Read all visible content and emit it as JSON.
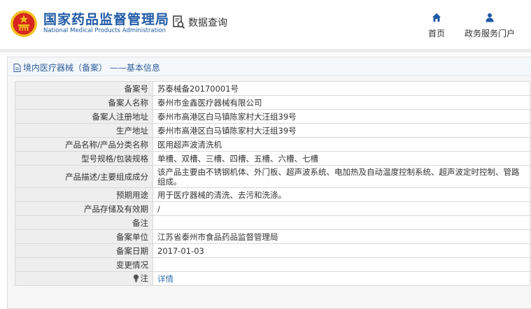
{
  "header": {
    "brand_cn": "国家药品监督管理局",
    "brand_en": "National Medical Products Administration",
    "query_label": "数据查询",
    "nav": {
      "home": "首页",
      "portal": "政务服务门户"
    }
  },
  "panel": {
    "title": "境内医疗器械（备案） ——基本信息"
  },
  "records": [
    {
      "key": "备案号",
      "value": "苏泰械备20170001号"
    },
    {
      "key": "备案人名称",
      "value": "泰州市金鑫医疗器械有限公司"
    },
    {
      "key": "备案人注册地址",
      "value": "泰州市高港区白马镇陈家村大汪组39号"
    },
    {
      "key": "生产地址",
      "value": "泰州市高港区白马镇陈家村大汪组39号"
    },
    {
      "key": "产品名称/产品分类名称",
      "value": "医用超声波清洗机"
    },
    {
      "key": "型号规格/包装规格",
      "value": "单槽、双槽、三槽、四槽、五槽、六槽、七槽"
    },
    {
      "key": "产品描述/主要组成成分",
      "value": "该产品主要由不锈钢机体、外门板、超声波系统、电加热及自动温度控制系统、超声波定时控制、管路组成。"
    },
    {
      "key": "预期用途",
      "value": "用于医疗器械的清洗、去污和洗涤。"
    },
    {
      "key": "产品存储及有效期",
      "value": "/"
    },
    {
      "key": "备注",
      "value": ""
    },
    {
      "key": "备案单位",
      "value": "江苏省泰州市食品药品监督管理局"
    },
    {
      "key": "备案日期",
      "value": "2017-01-03"
    },
    {
      "key": "变更情况",
      "value": ""
    }
  ],
  "note": {
    "key": "注",
    "link": "详情",
    "icon": "lightbulb-icon"
  },
  "colors": {
    "brand": "#1f5aa6",
    "link": "#2f6fb5",
    "emblem_red": "#d7261e",
    "emblem_gold": "#f2c21b"
  }
}
